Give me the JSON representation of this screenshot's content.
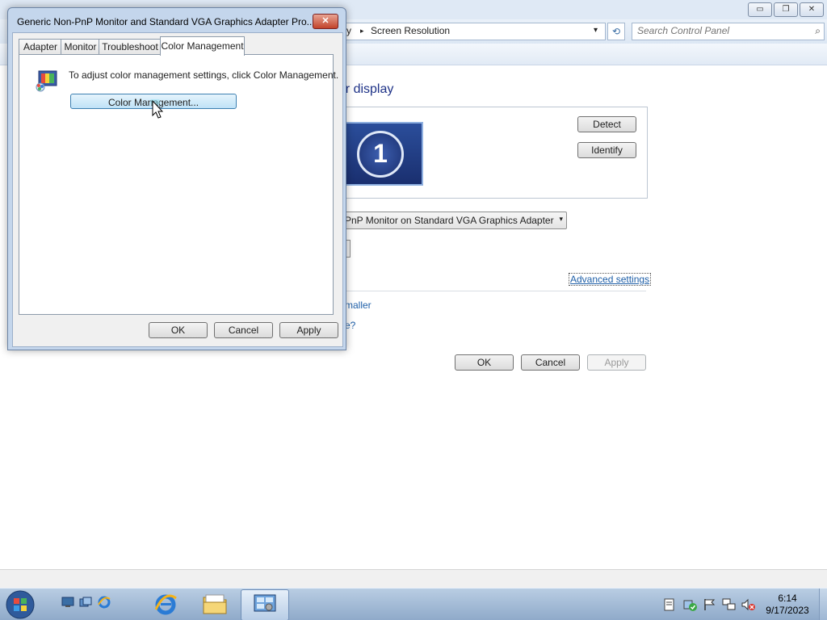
{
  "background_window": {
    "caption_buttons": {
      "minimize": "▭",
      "restore": "❐",
      "close": "✕"
    },
    "address_bar": {
      "crumb_prefix": "y",
      "separator": "▸",
      "current": "Screen Resolution",
      "dropdown": "▾"
    },
    "refresh_glyph": "⟲",
    "search": {
      "placeholder": "Search Control Panel",
      "icon": "⌕"
    },
    "heading": "our display",
    "monitor_number": "1",
    "detect_label": "Detect",
    "identify_label": "Identify",
    "display_select": {
      "value": "PnP Monitor on Standard VGA Graphics Adapter",
      "arrow": "▾"
    },
    "advanced_link": "Advanced settings",
    "link_smaller": "maller",
    "link_question": "e?",
    "ok_label": "OK",
    "cancel_label": "Cancel",
    "apply_label": "Apply"
  },
  "dialog": {
    "title": "Generic Non-PnP Monitor and Standard VGA Graphics Adapter Pro...",
    "close_glyph": "✕",
    "tabs": [
      {
        "label": "Adapter"
      },
      {
        "label": "Monitor"
      },
      {
        "label": "Troubleshoot"
      },
      {
        "label": "Color Management"
      }
    ],
    "active_tab": "Color Management",
    "instruction": "To adjust color management settings, click Color Management.",
    "color_management_button": "Color Management...",
    "ok_label": "OK",
    "cancel_label": "Cancel",
    "apply_label": "Apply"
  },
  "taskbar": {
    "clock_time": "6:14",
    "clock_date": "9/17/2023",
    "start_icon": "windows-logo",
    "quick_launch": [
      "show-desktop-icon",
      "switch-windows-icon",
      "internet-explorer-icon"
    ],
    "pinned": [
      "internet-explorer-icon",
      "windows-explorer-icon",
      "control-panel-icon"
    ],
    "tray": [
      "notes-icon",
      "action-center-icon",
      "flag-icon",
      "network-icon",
      "volume-muted-icon"
    ]
  }
}
